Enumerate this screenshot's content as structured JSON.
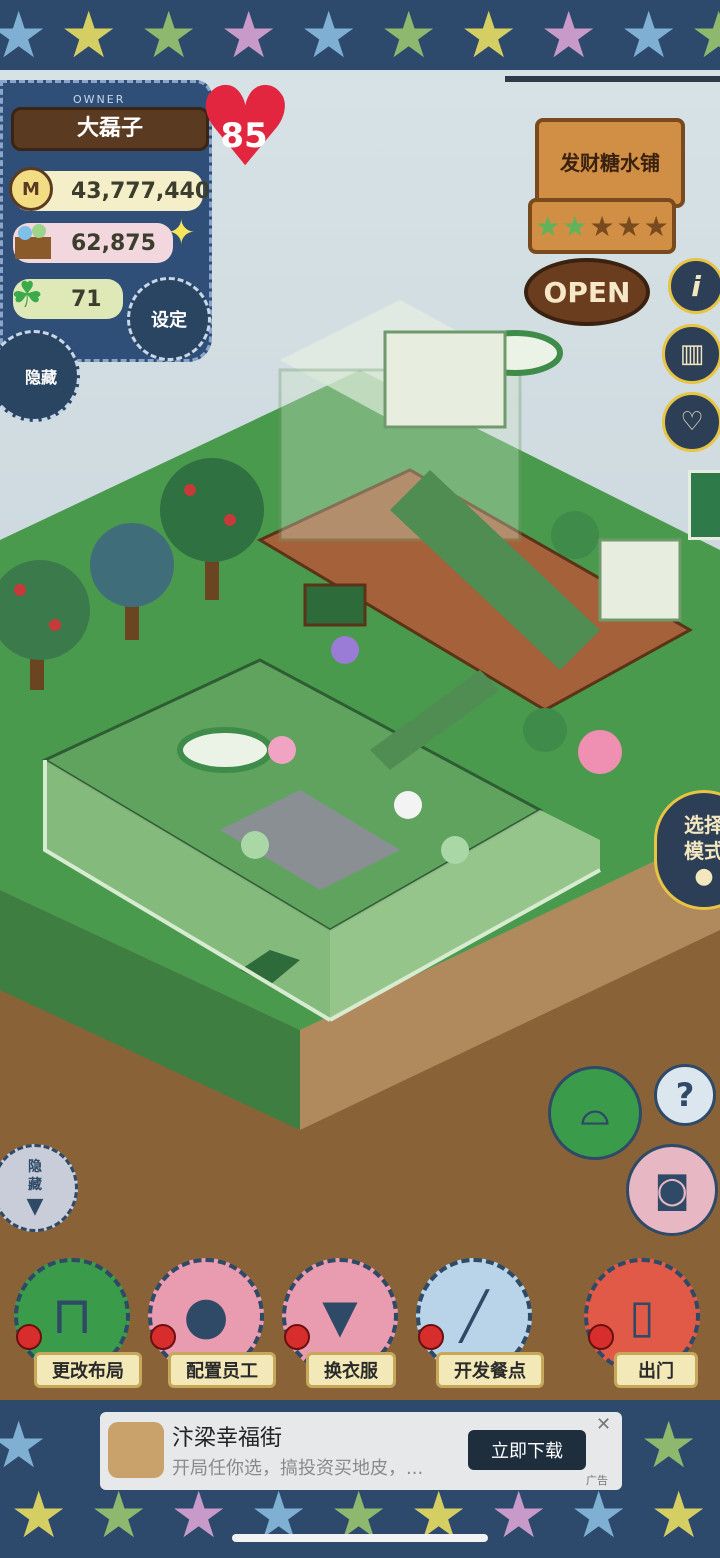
{
  "player": {
    "owner_label": "OWNER",
    "name": "大磊子",
    "level": "85",
    "coins": "43,777,440",
    "food_stock": "62,875",
    "clovers": "71"
  },
  "buttons": {
    "settings": "设定",
    "hide_top": "隐藏",
    "hide_bottom": "隐藏",
    "select_mode": "选择模式",
    "help": "?"
  },
  "shop": {
    "name": "发财糖水铺",
    "status": "OPEN",
    "stars_earned": 2,
    "stars_total": 5
  },
  "dock": [
    {
      "label": "更改布局",
      "icon": "table-icon",
      "color": "#3a9b4a"
    },
    {
      "label": "配置员工",
      "icon": "bear-head-icon",
      "color": "#e99bb0"
    },
    {
      "label": "换衣服",
      "icon": "shirt-icon",
      "color": "#e99bb0"
    },
    {
      "label": "开发餐点",
      "icon": "knife-icon",
      "color": "#b9d3e8"
    },
    {
      "label": "出门",
      "icon": "door-icon",
      "color": "#e05a47"
    }
  ],
  "ad": {
    "title": "汴梁幸福街",
    "subtitle": "开局任你选，搞投资买地皮，...",
    "cta": "立即下载",
    "tag": "广告"
  },
  "colors": {
    "star_band": "#2d4a6c",
    "grass": "#4a9a4e",
    "heart": "#e2263f",
    "wood_sign": "#d08f44"
  }
}
